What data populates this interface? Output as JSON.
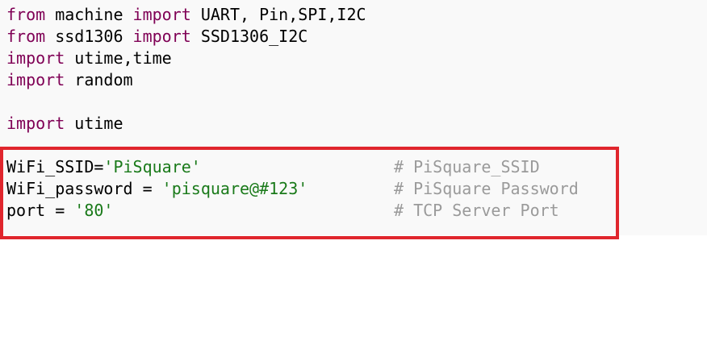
{
  "colors": {
    "keyword": "#7f0055",
    "string": "#1a7a1a",
    "comment": "#9a9a9a",
    "highlight_border": "#e0262d",
    "editor_bg": "#f9f9f9"
  },
  "code": {
    "line1": {
      "kw1": "from",
      "mod": " machine ",
      "kw2": "import",
      "rest": " UART, Pin,SPI,I2C"
    },
    "line2": {
      "kw1": "from",
      "mod": " ssd1306 ",
      "kw2": "import",
      "rest": " SSD1306_I2C"
    },
    "line3": {
      "kw": "import",
      "rest": " utime,time"
    },
    "line4": {
      "kw": "import",
      "rest": " random"
    },
    "line6": {
      "kw": "import",
      "rest": " utime"
    },
    "line8": {
      "var": "WiFi_SSID=",
      "str": "'PiSquare'",
      "comment": "# PiSquare_SSID"
    },
    "line9": {
      "var": "WiFi_password = ",
      "str": "'pisquare@#123'",
      "comment": "# PiSquare Password"
    },
    "line10": {
      "var": "port = ",
      "str": "'80'",
      "comment": "# TCP Server Port"
    }
  }
}
